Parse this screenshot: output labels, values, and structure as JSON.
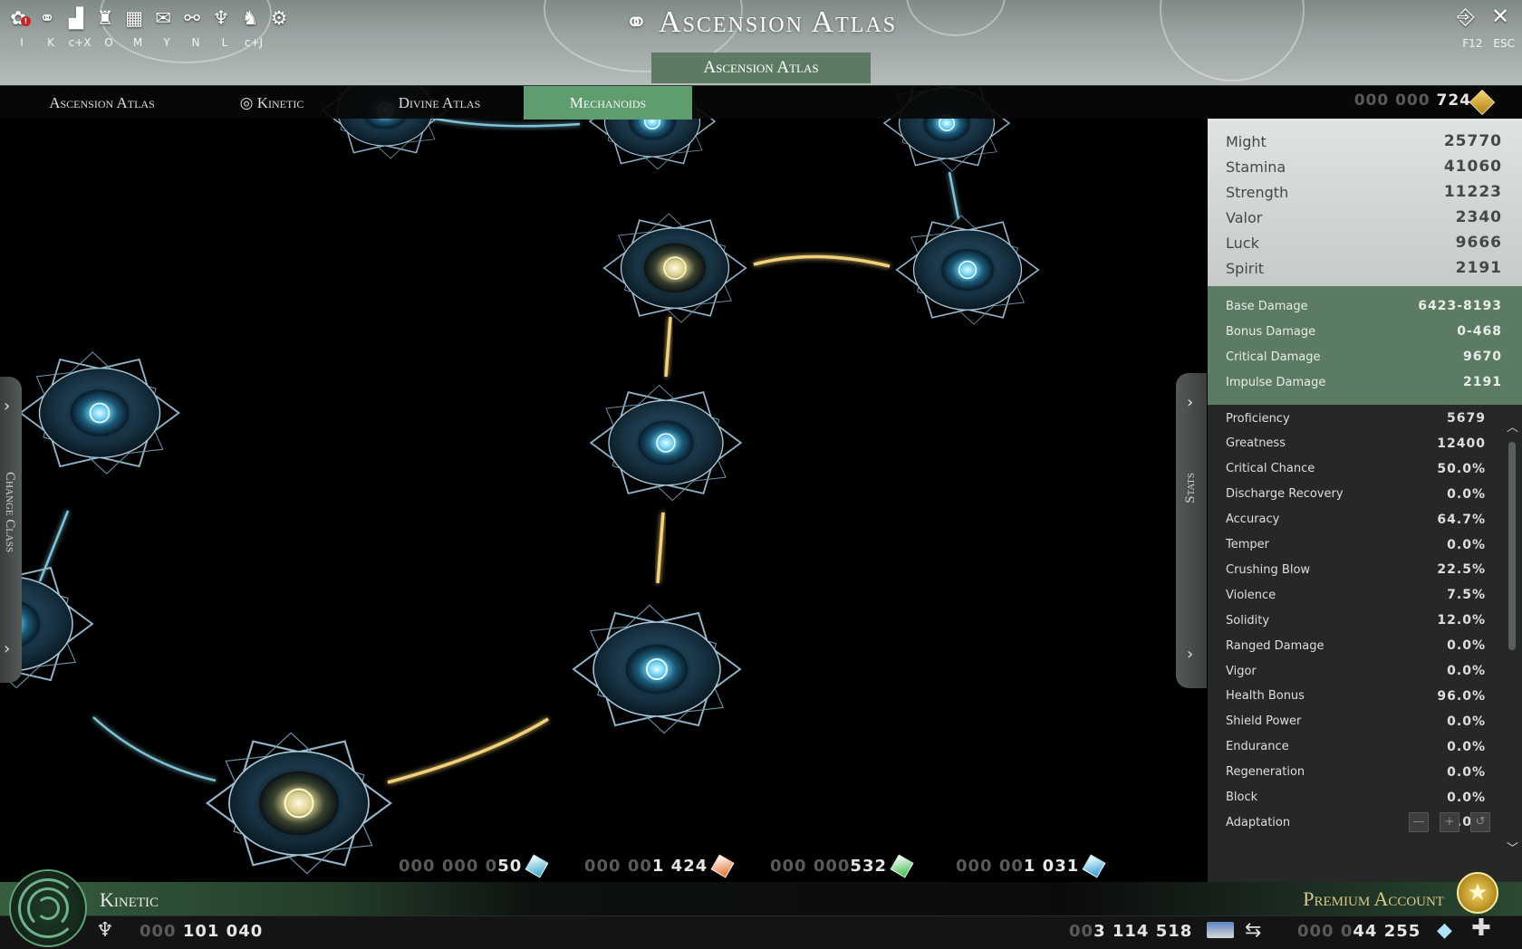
{
  "topbar": {
    "title": "Ascension Atlas",
    "title_tab": "Ascension Atlas",
    "icons": [
      "alert-badge-icon",
      "network-icon",
      "stats-bars-icon",
      "armor-icon",
      "map-icon",
      "chat-icon",
      "handshake-icon",
      "guild-crest-icon",
      "unicorn-icon",
      "gear-icon"
    ],
    "alert_count": "!",
    "shortcuts": [
      "I",
      "K",
      "c+X",
      "O",
      "M",
      "Y",
      "N",
      "L",
      "c+J"
    ],
    "key_exit": "F12",
    "key_close": "ESC"
  },
  "nav": {
    "tabs": [
      {
        "label": "Ascension Atlas"
      },
      {
        "label": "Kinetic"
      },
      {
        "label": "Divine Atlas"
      },
      {
        "label": "Mechanoids"
      }
    ],
    "gold_prefix": "000 000",
    "gold_value": "724"
  },
  "side": {
    "change_class": "Change Class",
    "stats": "Stats"
  },
  "stats": {
    "primary": [
      {
        "label": "Might",
        "value": "25770"
      },
      {
        "label": "Stamina",
        "value": "41060"
      },
      {
        "label": "Strength",
        "value": "11223"
      },
      {
        "label": "Valor",
        "value": "2340"
      },
      {
        "label": "Luck",
        "value": "9666"
      },
      {
        "label": "Spirit",
        "value": "2191"
      }
    ],
    "damage": [
      {
        "label": "Base Damage",
        "value": "6423-8193"
      },
      {
        "label": "Bonus Damage",
        "value": "0-468"
      },
      {
        "label": "Critical Damage",
        "value": "9670"
      },
      {
        "label": "Impulse Damage",
        "value": "2191"
      }
    ],
    "secondary": [
      {
        "label": "Proficiency",
        "value": "5679"
      },
      {
        "label": "Greatness",
        "value": "12400"
      },
      {
        "label": "Critical Chance",
        "value": "50.0%"
      },
      {
        "label": "Discharge Recovery",
        "value": "0.0%"
      },
      {
        "label": "Accuracy",
        "value": "64.7%"
      },
      {
        "label": "Temper",
        "value": "0.0%"
      },
      {
        "label": "Crushing Blow",
        "value": "22.5%"
      },
      {
        "label": "Violence",
        "value": "7.5%"
      },
      {
        "label": "Solidity",
        "value": "12.0%"
      },
      {
        "label": "Ranged Damage",
        "value": "0.0%"
      },
      {
        "label": "Vigor",
        "value": "0.0%"
      },
      {
        "label": "Health Bonus",
        "value": "96.0%"
      },
      {
        "label": "Shield Power",
        "value": "0.0%"
      },
      {
        "label": "Endurance",
        "value": "0.0%"
      },
      {
        "label": "Regeneration",
        "value": "0.0%"
      },
      {
        "label": "Block",
        "value": "0.0%"
      },
      {
        "label": "Adaptation",
        "value": "0.0%"
      }
    ]
  },
  "resources": [
    {
      "dim": "000 000 0",
      "value": "50",
      "color": "#2fa6c9"
    },
    {
      "dim": "000 00",
      "value": "1 424",
      "color": "#e0702a"
    },
    {
      "dim": "000 000 ",
      "value": "532",
      "color": "#3bbd4a"
    },
    {
      "dim": "000 00",
      "value": "1 031",
      "color": "#2b9fd6"
    }
  ],
  "bottom": {
    "class_name": "Kinetic",
    "premium": "Premium Account",
    "xp_dim": "000 ",
    "xp_value": "101 040",
    "credits_dim": "00",
    "credits_value": "3 114 518",
    "gems_dim": "000 0",
    "gems_value": "44 255"
  },
  "colors": {
    "accent_green": "#5f9d6f",
    "node_glow": "#58c8ef",
    "active_path": "#f3d17a",
    "inactive_path": "#7fc4d8"
  }
}
